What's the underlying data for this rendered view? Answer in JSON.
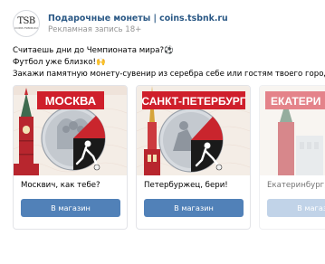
{
  "post": {
    "avatar_text": "TSB",
    "avatar_sub": "COINS.TSBNK.RU",
    "author": "Подарочные монеты | coins.tsbnk.ru",
    "promo": "Рекламная запись 18+",
    "lines": [
      "Считаешь дни до Чемпионата мира?⚽",
      "Футбол уже близко!🙌",
      "Закажи памятную монету-сувенир из серебра себе или гостям твоего города!"
    ]
  },
  "cards": [
    {
      "banner": "МОСКВА",
      "caption": "Москвич, как тебе?",
      "button": "В магазин",
      "banner_color": "#cf1f2b"
    },
    {
      "banner": "САНКТ-ПЕТЕРБУРГ",
      "caption": "Петербуржец, бери!",
      "button": "В магазин",
      "banner_color": "#cf1f2b"
    },
    {
      "banner": "ЕКАТЕРИ",
      "caption": "Екатеринбург, д",
      "button": "В магазин",
      "banner_color": "#cf1f2b"
    }
  ],
  "colors": {
    "link": "#2a5885",
    "button": "#5181b8",
    "promo": "#939393"
  }
}
